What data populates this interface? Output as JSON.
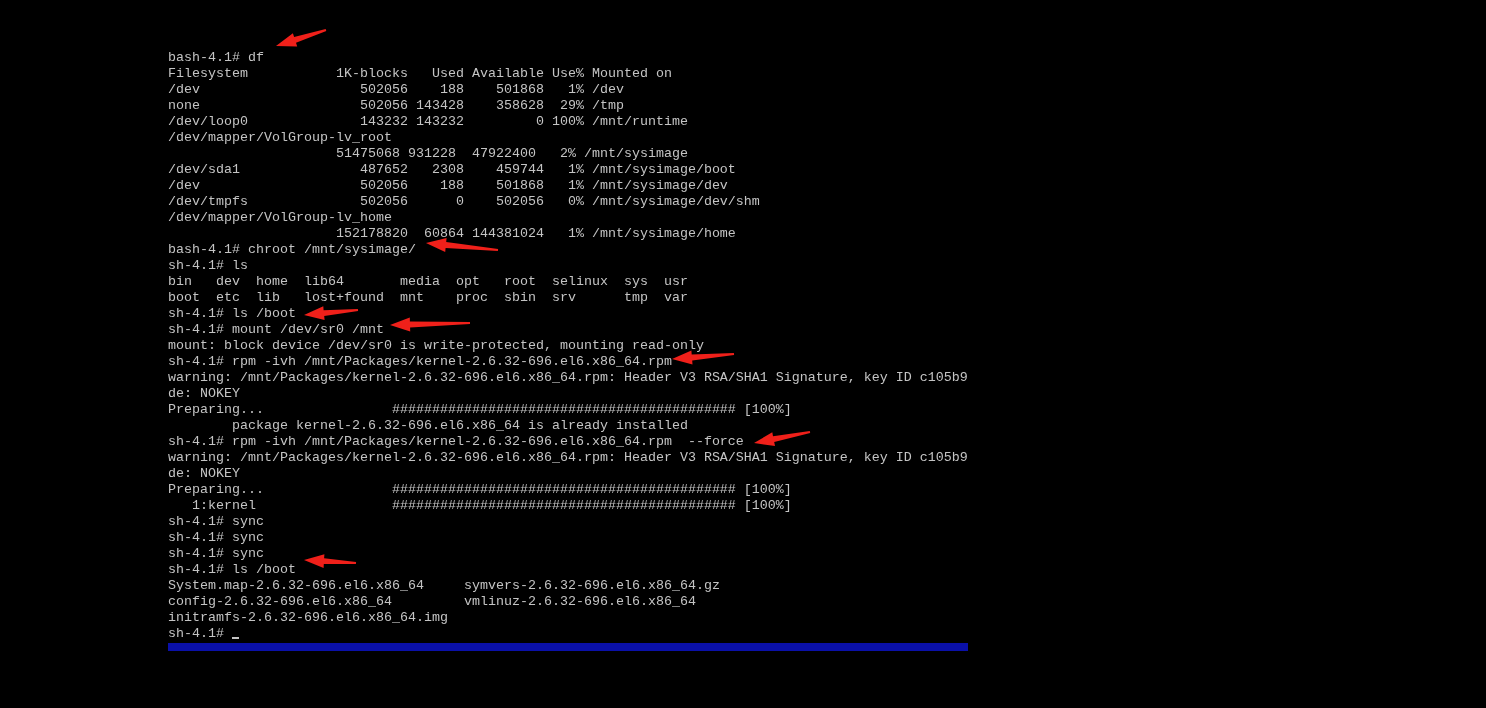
{
  "terminal": {
    "lines": [
      "bash-4.1# df",
      "Filesystem           1K-blocks   Used Available Use% Mounted on",
      "/dev                    502056    188    501868   1% /dev",
      "none                    502056 143428    358628  29% /tmp",
      "/dev/loop0              143232 143232         0 100% /mnt/runtime",
      "/dev/mapper/VolGroup-lv_root",
      "                     51475068 931228  47922400   2% /mnt/sysimage",
      "/dev/sda1               487652   2308    459744   1% /mnt/sysimage/boot",
      "/dev                    502056    188    501868   1% /mnt/sysimage/dev",
      "/dev/tmpfs              502056      0    502056   0% /mnt/sysimage/dev/shm",
      "/dev/mapper/VolGroup-lv_home",
      "                     152178820  60864 144381024   1% /mnt/sysimage/home",
      "bash-4.1# chroot /mnt/sysimage/",
      "sh-4.1# ls",
      "bin   dev  home  lib64       media  opt   root  selinux  sys  usr",
      "boot  etc  lib   lost+found  mnt    proc  sbin  srv      tmp  var",
      "sh-4.1# ls /boot",
      "sh-4.1# mount /dev/sr0 /mnt",
      "mount: block device /dev/sr0 is write-protected, mounting read-only",
      "sh-4.1# rpm -ivh /mnt/Packages/kernel-2.6.32-696.el6.x86_64.rpm",
      "warning: /mnt/Packages/kernel-2.6.32-696.el6.x86_64.rpm: Header V3 RSA/SHA1 Signature, key ID c105b9",
      "de: NOKEY",
      "Preparing...                ########################################### [100%]",
      "        package kernel-2.6.32-696.el6.x86_64 is already installed",
      "sh-4.1# rpm -ivh /mnt/Packages/kernel-2.6.32-696.el6.x86_64.rpm  --force",
      "warning: /mnt/Packages/kernel-2.6.32-696.el6.x86_64.rpm: Header V3 RSA/SHA1 Signature, key ID c105b9",
      "de: NOKEY",
      "Preparing...                ########################################### [100%]",
      "   1:kernel                 ########################################### [100%]",
      "sh-4.1# sync",
      "sh-4.1# sync",
      "sh-4.1# sync",
      "sh-4.1# ls /boot",
      "System.map-2.6.32-696.el6.x86_64     symvers-2.6.32-696.el6.x86_64.gz",
      "config-2.6.32-696.el6.x86_64         vmlinuz-2.6.32-696.el6.x86_64",
      "initramfs-2.6.32-696.el6.x86_64.img"
    ],
    "prompt": "sh-4.1# "
  }
}
